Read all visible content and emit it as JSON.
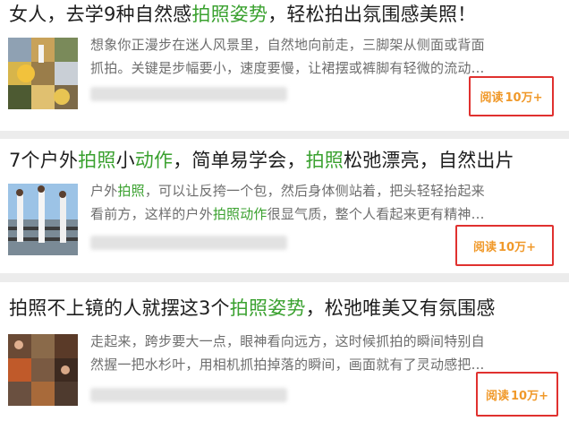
{
  "articles": [
    {
      "title_parts": [
        "女人，去学9种自然感",
        "拍照姿势",
        "，轻松拍出氛围感美照！"
      ],
      "desc_lines": [
        "想象你正漫步在迷人风景里，自然地向前走，三脚架从侧面或背面",
        "抓拍。关键是步幅要小，速度要慢，让裙摆或裤脚有轻微的流动..."
      ],
      "read_label": "阅读",
      "read_count": "10万+"
    },
    {
      "title_parts": [
        "7个户外",
        "拍照",
        "小",
        "动作",
        "，简单易学会，",
        "拍照",
        "松弛漂亮，自然出片"
      ],
      "desc_line1_parts": [
        "户外",
        "拍照",
        "，可以让反挎一个包，然后身体侧站着，把头轻轻抬起来"
      ],
      "desc_line2_parts": [
        "看前方，这样的户外",
        "拍照动作",
        "很显气质，整个人看起来更有精神..."
      ],
      "read_label": "阅读",
      "read_count": "10万+"
    },
    {
      "title_parts": [
        "拍照不上镜的人就摆这3个",
        "拍照姿势",
        "，松弛唯美又有氛围感"
      ],
      "desc_lines": [
        "走起来，跨步要大一点，眼神看向远方，这时候抓拍的瞬间特别自",
        "然握一把水杉叶，用相机抓拍掉落的瞬间，画面就有了灵动感把..."
      ],
      "read_label": "阅读",
      "read_count": "10万+"
    }
  ]
}
